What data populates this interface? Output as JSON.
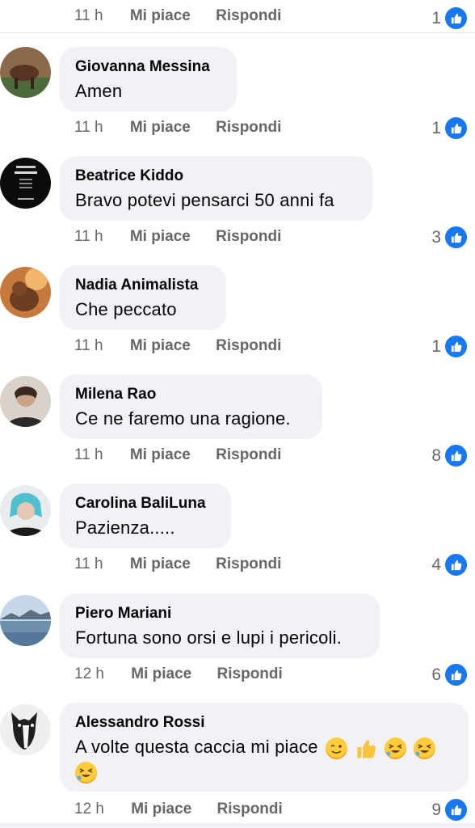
{
  "top_partial": {
    "time": "11 h",
    "like_label": "Mi piace",
    "reply_label": "Rispondi",
    "likes": "1"
  },
  "comments": [
    {
      "author": "Giovanna Messina",
      "text": "Amen",
      "time": "11 h",
      "like_label": "Mi piace",
      "reply_label": "Rispondi",
      "likes": "1",
      "avatar_color": "#6b4a34"
    },
    {
      "author": "Beatrice Kiddo",
      "text": "Bravo potevi pensarci 50 anni fa",
      "time": "11 h",
      "like_label": "Mi piace",
      "reply_label": "Rispondi",
      "likes": "3",
      "avatar_color": "#0b0b0b"
    },
    {
      "author": "Nadia Animalista",
      "text": "Che peccato",
      "time": "11 h",
      "like_label": "Mi piace",
      "reply_label": "Rispondi",
      "likes": "1",
      "avatar_color": "#a0603a"
    },
    {
      "author": "Milena Rao",
      "text": "Ce ne faremo una ragione.",
      "time": "11 h",
      "like_label": "Mi piace",
      "reply_label": "Rispondi",
      "likes": "8",
      "avatar_color": "#c9b8a8"
    },
    {
      "author": "Carolina BaliLuna",
      "text": "Pazienza.....",
      "time": "11 h",
      "like_label": "Mi piace",
      "reply_label": "Rispondi",
      "likes": "4",
      "avatar_color": "#5fb7c9"
    },
    {
      "author": "Piero Mariani",
      "text": "Fortuna sono orsi e lupi i pericoli.",
      "time": "12 h",
      "like_label": "Mi piace",
      "reply_label": "Rispondi",
      "likes": "6",
      "avatar_color": "#7e9bb8"
    },
    {
      "author": "Alessandro Rossi",
      "text": "A volte questa caccia mi piace",
      "time": "12 h",
      "like_label": "Mi piace",
      "reply_label": "Rispondi",
      "likes": "9",
      "avatar_color": "#d8d8d8"
    }
  ],
  "colors": {
    "accent": "#1877f2",
    "bubble": "#f0f2f5",
    "meta": "#65676b"
  },
  "emoji_names": [
    "winking-face-emoji",
    "thumbs-up-emoji",
    "rolling-laughing-emoji",
    "rolling-laughing-emoji",
    "rolling-laughing-emoji"
  ]
}
